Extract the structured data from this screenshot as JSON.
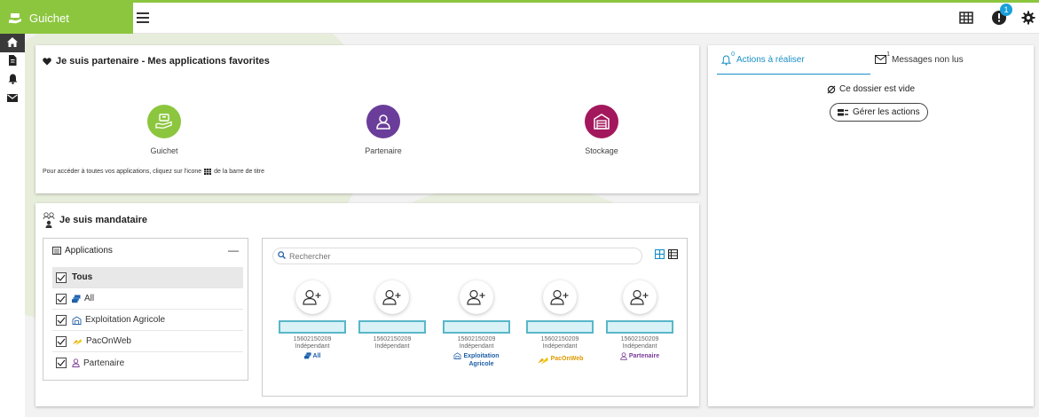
{
  "header": {
    "brand_title": "Guichet",
    "brand_color": "#8cc63f",
    "notification_count": "1",
    "icons": [
      "menu-icon",
      "apps-grid-icon",
      "notification-icon",
      "gear-icon"
    ]
  },
  "sidenav": {
    "items": [
      {
        "name": "home",
        "icon": "home-icon",
        "active": true
      },
      {
        "name": "documents",
        "icon": "document-icon"
      },
      {
        "name": "alerts",
        "icon": "bell-icon"
      },
      {
        "name": "messages",
        "icon": "envelope-icon"
      }
    ]
  },
  "favorites": {
    "title": "Je suis partenaire - Mes applications favorites",
    "apps": [
      {
        "label": "Guichet",
        "color": "#8cc63f"
      },
      {
        "label": "Partenaire",
        "color": "#6a3d9a"
      },
      {
        "label": "Stockage",
        "color": "#a3185c"
      }
    ],
    "hint_before": "Pour accéder à toutes vos applications, cliquez sur l'icone",
    "hint_after": "de la barre de titre"
  },
  "mandataire": {
    "title": "Je suis mandataire",
    "filter": {
      "title": "Applications",
      "collapse_label": "—",
      "items": [
        {
          "label": "Tous",
          "checked": true,
          "selected": true
        },
        {
          "label": "All",
          "checked": true,
          "icon": "stack-icon"
        },
        {
          "label": "Exploitation Agricole",
          "checked": true,
          "icon": "farm-building-icon"
        },
        {
          "label": "PacOnWeb",
          "checked": true,
          "icon": "paconweb-logo-icon"
        },
        {
          "label": "Partenaire",
          "checked": true,
          "icon": "person-outline-icon"
        }
      ]
    },
    "search": {
      "placeholder": "Rechercher"
    },
    "cards": [
      {
        "id": "15602150209",
        "type": "Indépendant",
        "app": "All",
        "app_line2": ""
      },
      {
        "id": "15602150209",
        "type": "Indépendant",
        "app": "",
        "app_line2": ""
      },
      {
        "id": "15602150209",
        "type": "Indépendant",
        "app": "Exploitation",
        "app_line2": "Agricole"
      },
      {
        "id": "15602150209",
        "type": "Indépendant",
        "app": "PacOnWeb",
        "app_line2": ""
      },
      {
        "id": "15602150209",
        "type": "Indépendant",
        "app": "Partenaire",
        "app_line2": ""
      }
    ]
  },
  "actions": {
    "tab_actions": "Actions à réaliser",
    "tab_actions_count": "0",
    "tab_messages": "Messages non lus",
    "tab_messages_count": "1",
    "empty_text": "Ce dossier est vide",
    "manage_button": "Gérer les actions"
  }
}
